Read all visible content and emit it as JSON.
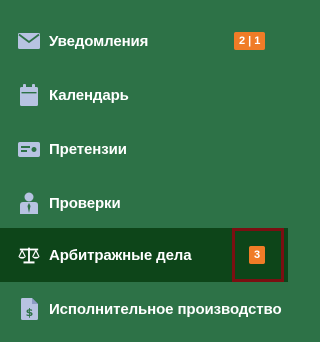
{
  "menu": {
    "items": [
      {
        "label": "Уведомления",
        "icon": "envelope-icon",
        "badge": "2 | 1"
      },
      {
        "label": "Календарь",
        "icon": "calendar-icon"
      },
      {
        "label": "Претензии",
        "icon": "card-icon"
      },
      {
        "label": "Проверки",
        "icon": "inspector-icon"
      },
      {
        "label": "Арбитражные дела",
        "icon": "scales-icon",
        "badge": "3",
        "active": true
      },
      {
        "label": "Исполнительное производство",
        "icon": "dollar-document-icon"
      }
    ]
  },
  "colors": {
    "background": "#2d7247",
    "active_background": "#0d4519",
    "badge": "#f07c27",
    "highlight_border": "#7b0f12",
    "icon": "#b7c3e2"
  }
}
